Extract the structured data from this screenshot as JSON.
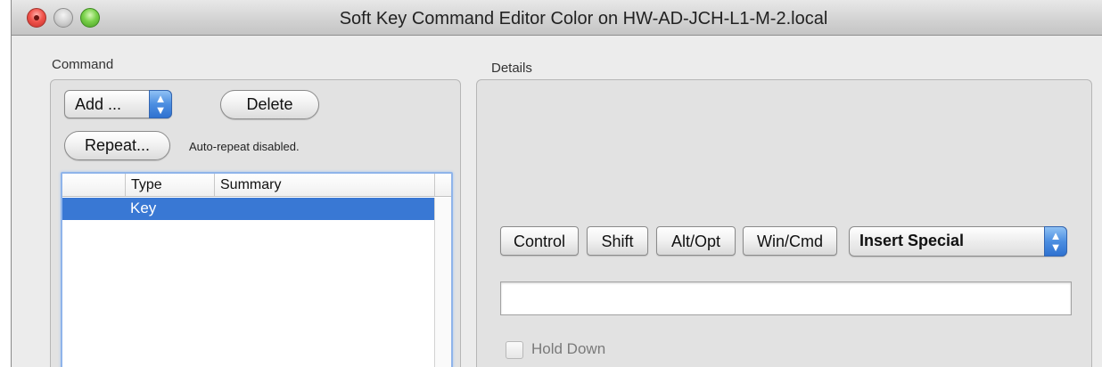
{
  "window": {
    "title": "Soft Key Command Editor Color on  HW-AD-JCH-L1-M-2.local"
  },
  "command": {
    "group_label": "Command",
    "add_popup": "Add ...",
    "delete_label": "Delete",
    "repeat_label": "Repeat...",
    "autorepeat_status": "Auto-repeat disabled.",
    "table": {
      "columns": [
        "",
        "Type",
        "Summary"
      ],
      "rows": [
        {
          "type": "Key",
          "summary": "",
          "selected": true
        }
      ]
    }
  },
  "details": {
    "group_label": "Details",
    "modifiers": [
      "Control",
      "Shift",
      "Alt/Opt",
      "Win/Cmd"
    ],
    "insert_special": "Insert Special",
    "key_field_value": "",
    "hold_down_label": "Hold Down",
    "hold_down_checked": false
  },
  "colors": {
    "selection": "#3978d4",
    "popup_stepper": "#4c8ee1",
    "close_button": "#f0544c",
    "zoom_button": "#79d14a"
  },
  "icons": [
    "close-window-icon",
    "minimize-window-icon",
    "zoom-window-icon",
    "popup-stepper-icon"
  ]
}
